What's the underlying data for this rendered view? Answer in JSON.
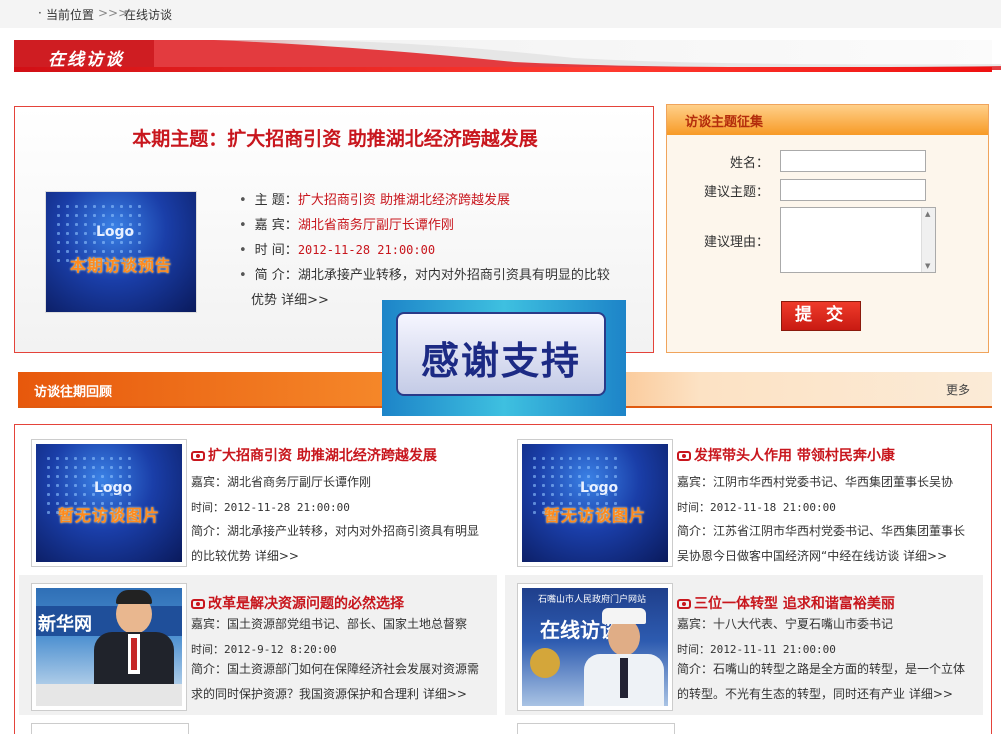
{
  "breadcrumb": {
    "bullet": "·",
    "label": "当前位置",
    "sep": ">>>",
    "current": "在线访谈"
  },
  "section_title": "在线访谈",
  "topic": {
    "title": "本期主题：扩大招商引资  助推湖北经济跨越发展",
    "image": {
      "logo": "Logo",
      "caption": "本期访谈预告"
    },
    "items": [
      {
        "bullet": "•",
        "label": "主  题：",
        "value": "扩大招商引资  助推湖北经济跨越发展"
      },
      {
        "bullet": "•",
        "label": "嘉  宾：",
        "value": "湖北省商务厅副厅长谭作刚"
      },
      {
        "bullet": "•",
        "label": "时  间：",
        "value": "2012-11-28 21:00:00"
      },
      {
        "bullet": "•",
        "label": "简  介：",
        "value": "湖北承接产业转移，对内对外招商引资具有明显的比较"
      }
    ],
    "intro_line2": "优势",
    "detail": "详细>>"
  },
  "collect": {
    "header": "访谈主题征集",
    "name_label": "姓名：",
    "subject_label": "建议主题：",
    "reason_label": "建议理由：",
    "submit": "提 交"
  },
  "past": {
    "title": "访谈往期回顾",
    "more": "更多"
  },
  "ad": {
    "text": "感谢支持"
  },
  "cards": [
    {
      "title": "扩大招商引资  助推湖北经济跨越发展",
      "guest": "嘉宾：湖北省商务厅副厅长谭作刚",
      "time": "时间：2012-11-28 21:00:00",
      "desc": "简介：湖北承接产业转移，对内对外招商引资具有明显的比较优势",
      "detail": "详细>>",
      "image": {
        "logo": "Logo",
        "caption": "暂无访谈图片"
      }
    },
    {
      "title": "发挥带头人作用  带领村民奔小康",
      "guest": "嘉宾：江阴市华西村党委书记、华西集团董事长吴协",
      "time": "时间：2012-11-18 21:00:00",
      "desc": "简介：江苏省江阴市华西村党委书记、华西集团董事长吴协恩今日做客中国经济网“中经在线访谈",
      "detail": "详细>>",
      "image": {
        "logo": "Logo",
        "caption": "暂无访谈图片"
      }
    },
    {
      "title": "改革是解决资源问题的必然选择",
      "guest": "嘉宾：国土资源部党组书记、部长、国家土地总督察",
      "time": "时间：2012-9-12 8:20:00",
      "desc": "简介：国土资源部门如何在保障经济社会发展对资源需求的同时保护资源？我国资源保护和合理利",
      "detail": "详细>>",
      "image": {
        "logo": "新华网"
      }
    },
    {
      "title": "三位一体转型  追求和谐富裕美丽",
      "guest": "嘉宾：十八大代表、宁夏石嘴山市委书记",
      "time": "时间：2012-11-11 21:00:00",
      "desc": "简介：石嘴山的转型之路是全方面的转型，是一个立体的转型。不光有生态的转型，同时还有产业",
      "detail": "详细>>",
      "image": {
        "logo": "在线访谈",
        "sign": "石嘴山市人民政府门户网站"
      }
    }
  ]
}
